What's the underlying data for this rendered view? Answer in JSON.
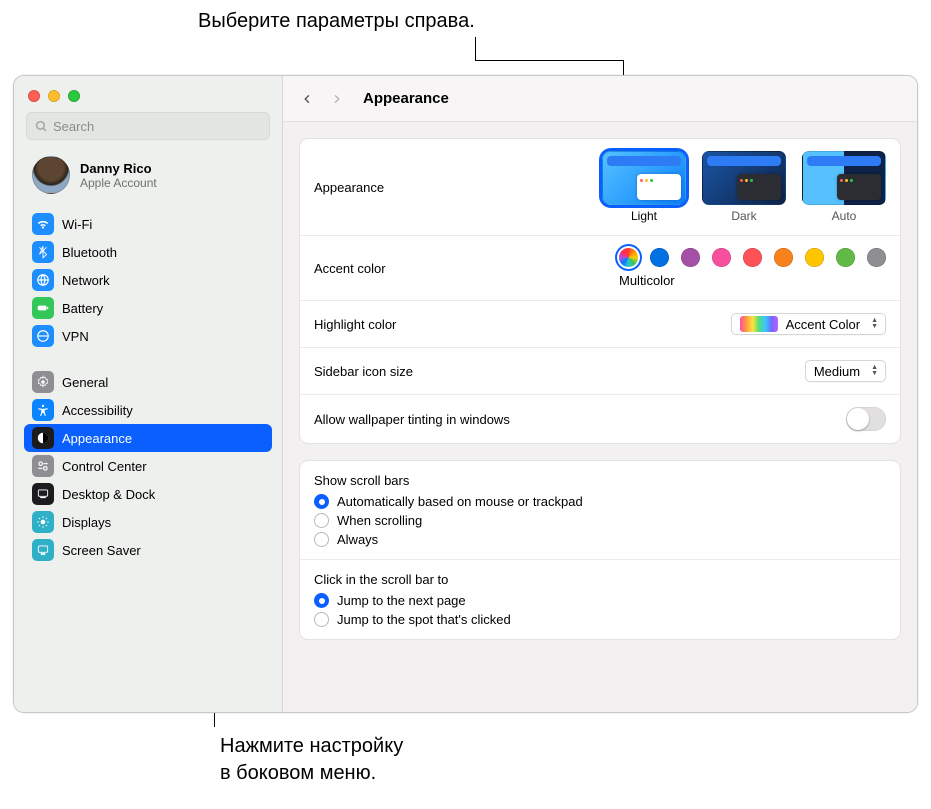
{
  "annotations": {
    "top": "Выберите параметры справа.",
    "bottom_line1": "Нажмите настройку",
    "bottom_line2": "в боковом меню."
  },
  "sidebar": {
    "search_placeholder": "Search",
    "account": {
      "name": "Danny Rico",
      "sub": "Apple Account"
    },
    "group1": [
      {
        "label": "Wi-Fi"
      },
      {
        "label": "Bluetooth"
      },
      {
        "label": "Network"
      },
      {
        "label": "Battery"
      },
      {
        "label": "VPN"
      }
    ],
    "group2": [
      {
        "label": "General"
      },
      {
        "label": "Accessibility"
      },
      {
        "label": "Appearance"
      },
      {
        "label": "Control Center"
      },
      {
        "label": "Desktop & Dock"
      },
      {
        "label": "Displays"
      },
      {
        "label": "Screen Saver"
      }
    ]
  },
  "content": {
    "title": "Appearance",
    "appearance": {
      "label": "Appearance",
      "options": {
        "light": "Light",
        "dark": "Dark",
        "auto": "Auto"
      },
      "selected": "light"
    },
    "accent": {
      "label": "Accent color",
      "caption": "Multicolor",
      "colors": [
        "multi",
        "#0071e3",
        "#a550a7",
        "#f74f9e",
        "#ff5257",
        "#f7821b",
        "#ffc600",
        "#62ba46",
        "#8e8e93"
      ],
      "selected_index": 0
    },
    "highlight": {
      "label": "Highlight color",
      "value": "Accent Color"
    },
    "sidebar_icon": {
      "label": "Sidebar icon size",
      "value": "Medium"
    },
    "tinting": {
      "label": "Allow wallpaper tinting in windows",
      "value": false
    },
    "scrollbars": {
      "label": "Show scroll bars",
      "options": [
        "Automatically based on mouse or trackpad",
        "When scrolling",
        "Always"
      ],
      "selected_index": 0
    },
    "scrollclick": {
      "label": "Click in the scroll bar to",
      "options": [
        "Jump to the next page",
        "Jump to the spot that's clicked"
      ],
      "selected_index": 0
    }
  }
}
